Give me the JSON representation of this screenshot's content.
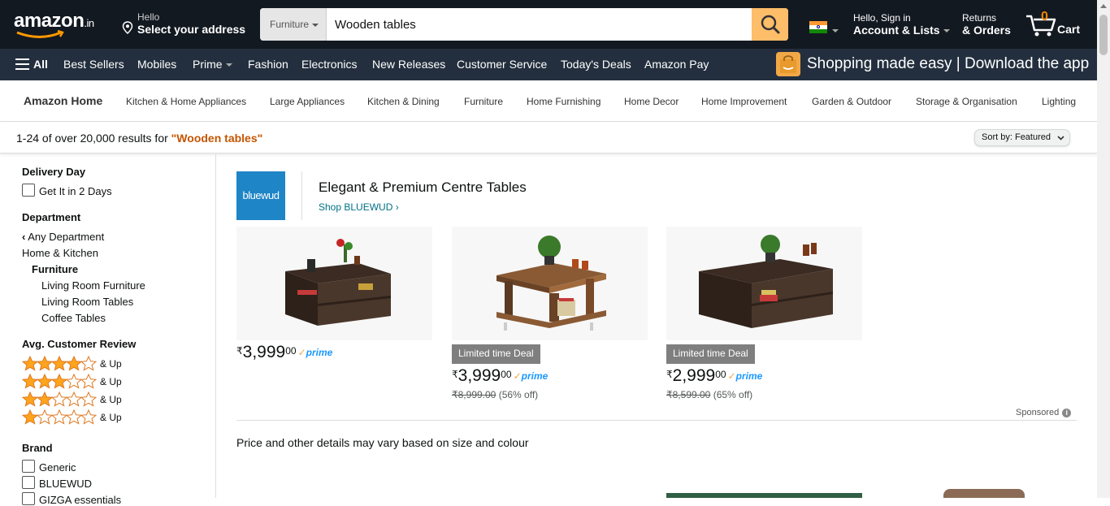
{
  "header": {
    "logo_text": "amazon",
    "logo_tld": ".in",
    "address_line1": "Hello",
    "address_line2": "Select your address",
    "search": {
      "category": "Furniture",
      "query": "Wooden tables"
    },
    "account_line1": "Hello, Sign in",
    "account_line2": "Account & Lists",
    "returns_line1": "Returns",
    "returns_line2": "& Orders",
    "cart_count": "0",
    "cart_label": "Cart"
  },
  "subnav": {
    "all_label": "All",
    "items": [
      "Best Sellers",
      "Mobiles",
      "Prime",
      "Fashion",
      "Electronics",
      "New Releases",
      "Customer Service",
      "Today's Deals",
      "Amazon Pay"
    ],
    "promo": "Shopping made easy | Download the app"
  },
  "category_bar": {
    "home": "Amazon Home",
    "items": [
      "Kitchen & Home Appliances",
      "Large Appliances",
      "Kitchen & Dining",
      "Furniture",
      "Home Furnishing",
      "Home Decor",
      "Home Improvement",
      "Garden & Outdoor",
      "Storage & Organisation",
      "Lighting"
    ]
  },
  "results": {
    "prefix": "1-24 of over 20,000 results for ",
    "term": "\"Wooden tables\"",
    "sort_label": "Sort by:",
    "sort_value": "Featured"
  },
  "sidebar": {
    "delivery_heading": "Delivery Day",
    "delivery_option": "Get It in 2 Days",
    "department_heading": "Department",
    "departments": [
      "Any Department",
      "Home & Kitchen",
      "Furniture",
      "Living Room Furniture",
      "Living Room Tables",
      "Coffee Tables"
    ],
    "review_heading": "Avg. Customer Review",
    "review_rows": [
      {
        "stars": 4,
        "label": "& Up"
      },
      {
        "stars": 3,
        "label": "& Up"
      },
      {
        "stars": 2,
        "label": "& Up"
      },
      {
        "stars": 1,
        "label": "& Up"
      }
    ],
    "brand_heading": "Brand",
    "brands": [
      "Generic",
      "BLUEWUD",
      "GIZGA essentials"
    ]
  },
  "sponsored_block": {
    "brand_logo_text": "bluewud",
    "title": "Elegant & Premium Centre Tables",
    "shop_link": "Shop BLUEWUD",
    "products": [
      {
        "deal": "",
        "currency": "₹",
        "price_whole": "3,999",
        "price_frac": "00",
        "prime": "prime",
        "was": "",
        "off": ""
      },
      {
        "deal": "Limited time Deal",
        "currency": "₹",
        "price_whole": "3,999",
        "price_frac": "00",
        "prime": "prime",
        "was": "₹8,999.00",
        "off": "(56% off)"
      },
      {
        "deal": "Limited time Deal",
        "currency": "₹",
        "price_whole": "2,999",
        "price_frac": "00",
        "prime": "prime",
        "was": "₹8,599.00",
        "off": "(65% off)"
      }
    ],
    "sponsored_label": "Sponsored"
  },
  "note": "Price and other details may vary based on size and colour",
  "colors": {
    "nav_bg": "#131921",
    "subnav_bg": "#232f3e",
    "search_button": "#febd69",
    "accent_orange": "#c45500",
    "link_teal": "#007185",
    "star": "#ffa41c",
    "prime_blue": "#1a98ff"
  }
}
